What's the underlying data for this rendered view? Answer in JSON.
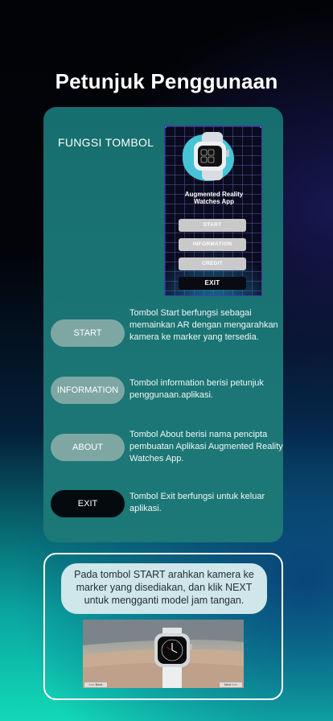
{
  "header": {
    "title": "Petunjuk Penggunaan"
  },
  "panel": {
    "heading": "FUNGSI TOMBOL",
    "preview": {
      "app_title_line1": "Augmented Reality",
      "app_title_line2": "Watches App",
      "buttons": [
        "START",
        "INFORMATION",
        "CREDIT",
        "EXIT"
      ]
    },
    "rows": [
      {
        "button": "START",
        "text": "Tombol Start berfungsi sebagai memainkan AR dengan mengarahkan kamera ke marker yang tersedia."
      },
      {
        "button": "INFORMATION",
        "text": "Tombol information berisi petunjuk penggunaan.aplikasi."
      },
      {
        "button": "ABOUT",
        "text": "Tombol About berisi nama pencipta pembuatan Aplikasi Augmented Reality Watches App."
      },
      {
        "button": "EXIT",
        "text": "Tombol Exit berfungsi untuk keluar aplikasi."
      }
    ]
  },
  "tip": {
    "text": "Pada tombol START arahkan kamera ke marker yang disediakan, dan klik NEXT untuk mengganti model jam tangan.",
    "photo_back_label": "<<< Back",
    "photo_next_label": "Next >>>"
  },
  "colors": {
    "panel": "#1b7474",
    "light_button": "#7ea7a4",
    "dark_button": "#050a0e",
    "tip_bubble": "#cfe6ea"
  }
}
